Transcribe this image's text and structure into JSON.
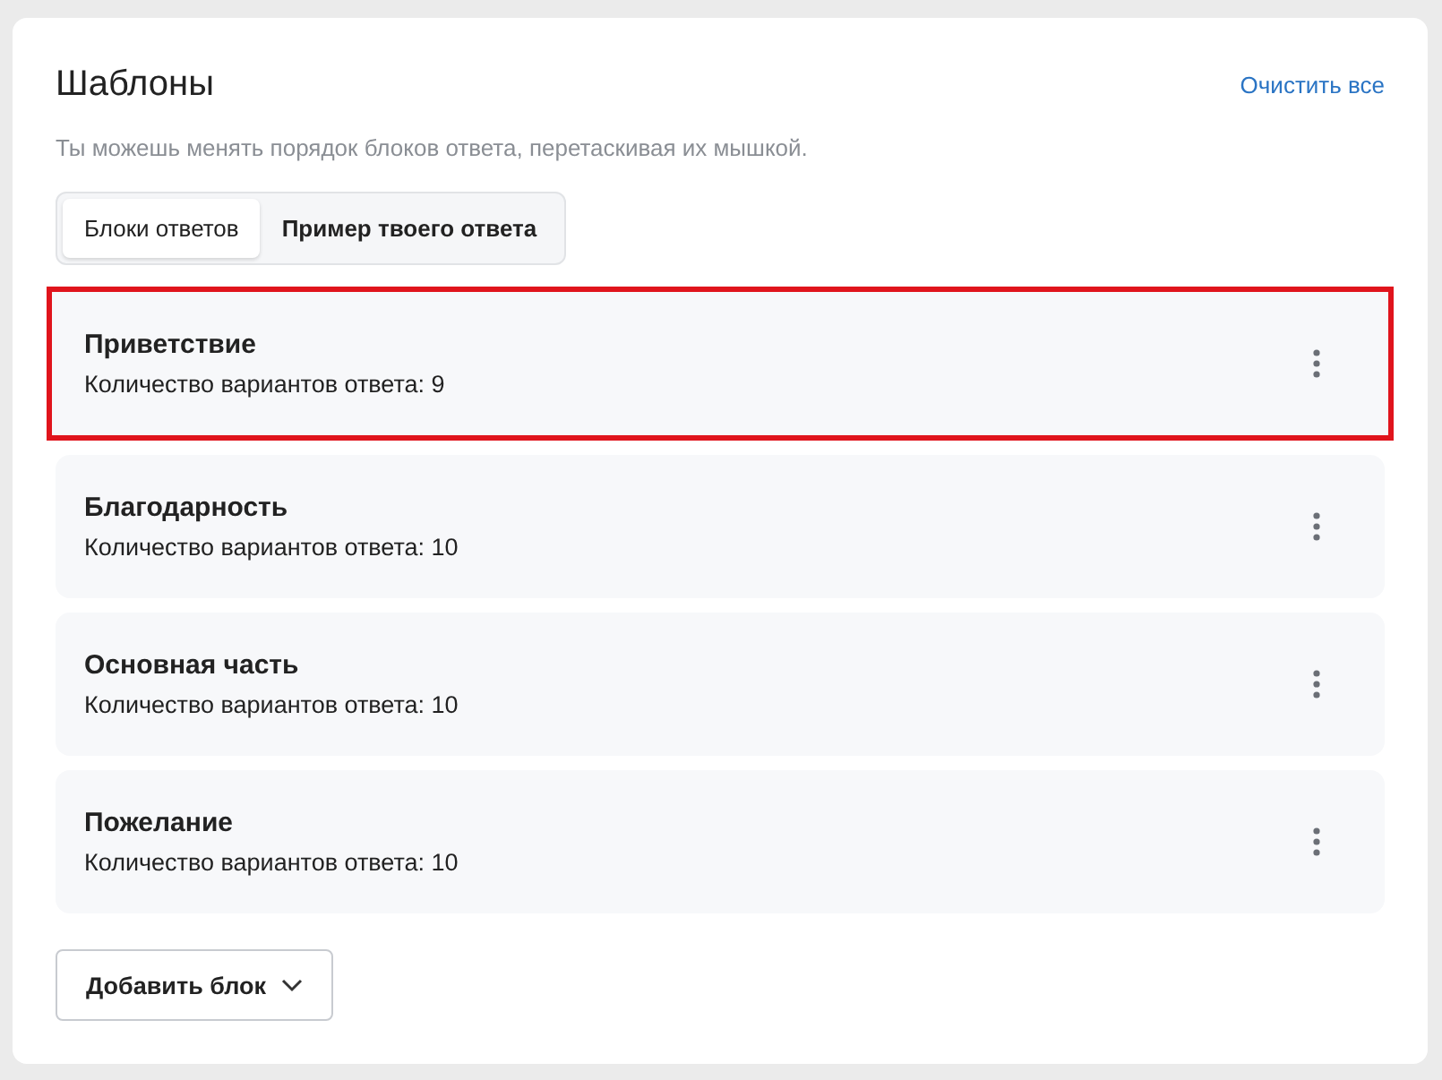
{
  "header": {
    "title": "Шаблоны",
    "clear_link": "Очистить все",
    "hint": "Ты можешь менять порядок блоков ответа, перетаскивая их мышкой."
  },
  "tabs": [
    {
      "label": "Блоки ответов",
      "selected": true
    },
    {
      "label": "Пример твоего ответа",
      "selected": false
    }
  ],
  "blocks": [
    {
      "title": "Приветствие",
      "count": "Количество вариантов ответа: 9",
      "highlighted": true
    },
    {
      "title": "Благодарность",
      "count": "Количество вариантов ответа: 10",
      "highlighted": false
    },
    {
      "title": "Основная часть",
      "count": "Количество вариантов ответа: 10",
      "highlighted": false
    },
    {
      "title": "Пожелание",
      "count": "Количество вариантов ответа: 10",
      "highlighted": false
    }
  ],
  "add_button": "Добавить блок"
}
